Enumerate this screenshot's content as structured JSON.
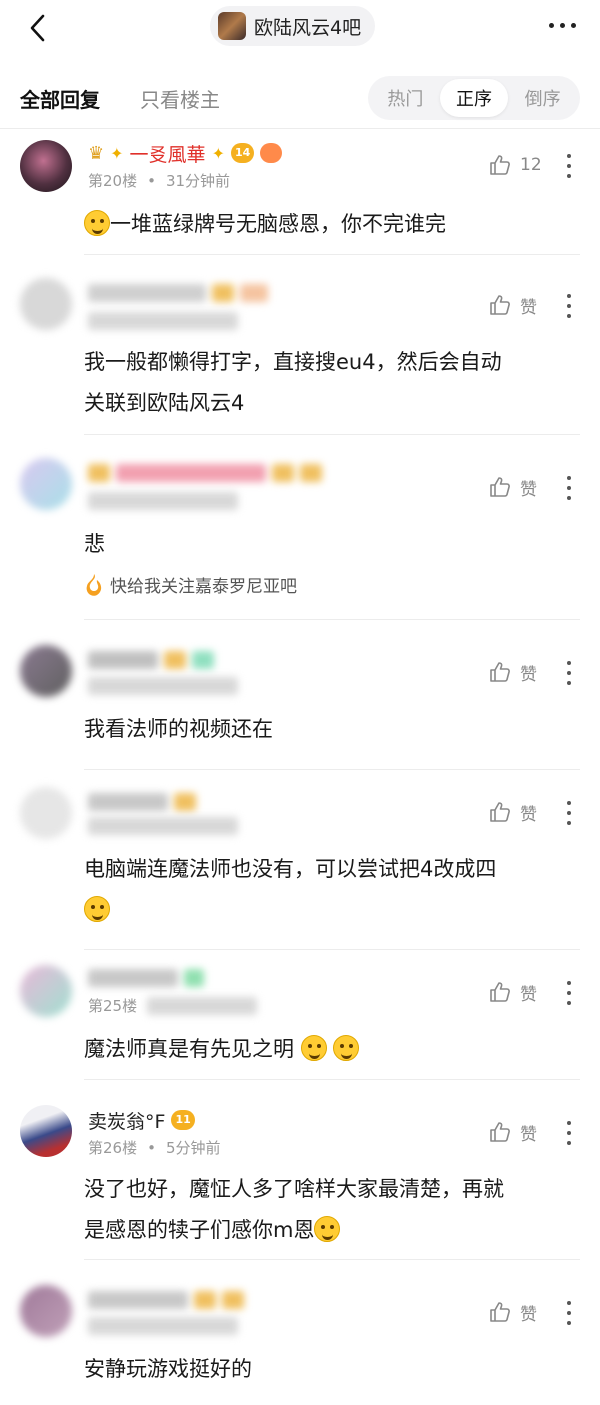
{
  "header": {
    "forum_name": "欧陆风云4吧",
    "back_icon": "back-chevron-icon",
    "more_icon": "more-dots-icon"
  },
  "filter": {
    "tab_all": "全部回复",
    "tab_host": "只看楼主",
    "sort": [
      "热门",
      "正序",
      "倒序"
    ],
    "active_sort": "正序"
  },
  "posts": [
    {
      "name": "一㕛風華",
      "floor": "第20楼",
      "time": "31分钟前",
      "likes": "12",
      "level": "14",
      "text": "一堆蓝绿牌号无脑感恩，你不完谁完",
      "blurred": false
    },
    {
      "likes": "赞",
      "text_lines": [
        "我一般都懒得打字，直接搜eu4，然后会自动",
        "关联到欧陆风云4"
      ],
      "blurred": true
    },
    {
      "likes": "赞",
      "text": "悲",
      "signature": "快给我关注嘉泰罗尼亚吧",
      "blurred": true
    },
    {
      "likes": "赞",
      "text": "我看法师的视频还在",
      "blurred": true
    },
    {
      "likes": "赞",
      "text": "电脑端连魔法师也没有，可以尝试把4改成四",
      "blurred": true
    },
    {
      "floor": "第25楼",
      "likes": "赞",
      "text": "魔法师真是有先见之明",
      "blurred": true
    },
    {
      "name": "卖炭翁°F",
      "floor": "第26楼",
      "time": "5分钟前",
      "level": "11",
      "likes": "赞",
      "text_lines": [
        "没了也好，魔怔人多了啥样大家最清楚，再就",
        "是感恩的犊子们感你m恩"
      ],
      "blurred": false
    },
    {
      "likes": "赞",
      "text": "安静玩游戏挺好的",
      "blurred": true
    }
  ]
}
